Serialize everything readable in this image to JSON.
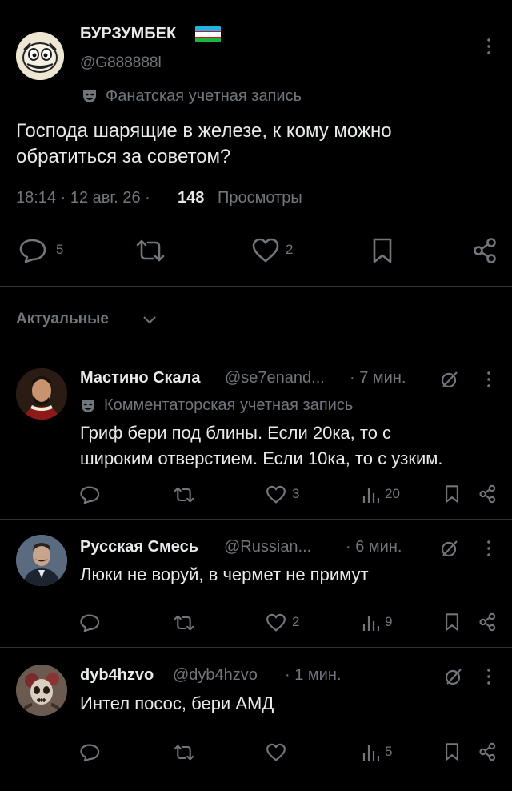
{
  "post": {
    "author_name": "БУРЗУМБЕК",
    "author_handle": "@G888888l",
    "fan_badge_label": "Фанатская учетная запись",
    "text_line1": "Господа шарящие в железе, к кому можно",
    "text_line2": "обратиться за советом?",
    "time": "18:14 · 12 авг. 26 ·",
    "views_count": "148",
    "views_label": "Просмотры",
    "replies": "5",
    "likes": "2"
  },
  "sort": {
    "label": "Актуальные"
  },
  "replies": [
    {
      "name": "Мастино Скала",
      "handle": "@se7enand...",
      "time": "· 7 мин.",
      "badge": "Комментаторская учетная запись",
      "text_line1": "Гриф бери под блины. Если 20ка, то с",
      "text_line2": "широким отверстием. Если 10ка, то с узким.",
      "likes": "3",
      "views": "20"
    },
    {
      "name": "Русская Смесь",
      "handle": "@Russian...",
      "time": "· 6 мин.",
      "text_line1": "Люки не воруй, в чермет не примут",
      "likes": "2",
      "views": "9"
    },
    {
      "name": "dyb4hzvo",
      "handle": "@dyb4hzvo",
      "time": "· 1 мин.",
      "text_line1": "Интел посос, бери АМД",
      "views": "5"
    }
  ],
  "colors": {
    "background": "#000000",
    "text": "#e7e9ea",
    "muted": "#71767b",
    "divider": "#2f3336"
  }
}
